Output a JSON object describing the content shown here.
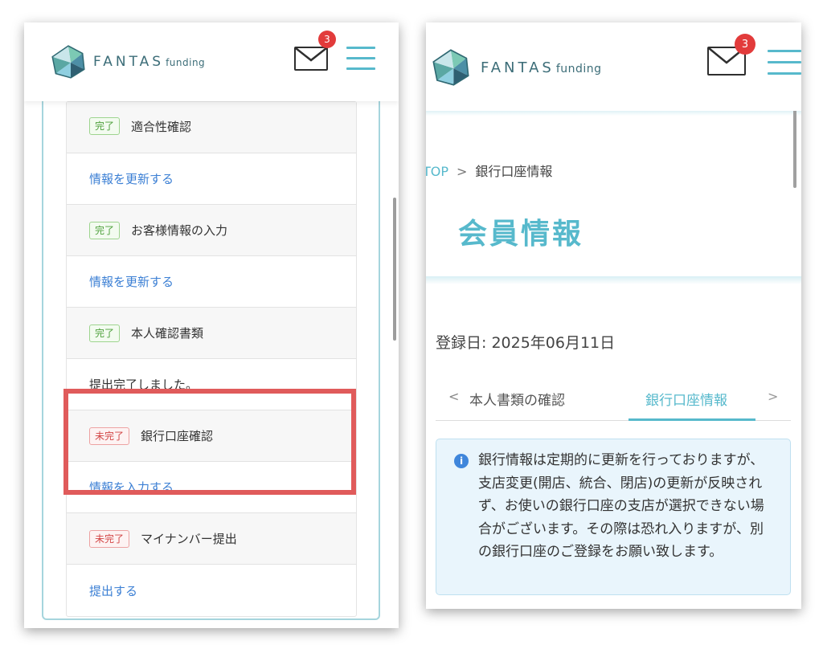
{
  "left": {
    "logo_main": "FANTAS",
    "logo_sub": "funding",
    "mail_badge": "3",
    "rows": [
      {
        "type": "status",
        "status": "完了",
        "label": "適合性確認"
      },
      {
        "type": "link",
        "label": "情報を更新する"
      },
      {
        "type": "status",
        "status": "完了",
        "label": "お客様情報の入力"
      },
      {
        "type": "link",
        "label": "情報を更新する"
      },
      {
        "type": "status",
        "status": "完了",
        "label": "本人確認書類"
      },
      {
        "type": "text",
        "label": "提出完了しました。"
      },
      {
        "type": "status",
        "status": "未完了",
        "label": "銀行口座確認"
      },
      {
        "type": "link",
        "label": "情報を入力する"
      },
      {
        "type": "status",
        "status": "未完了",
        "label": "マイナンバー提出"
      },
      {
        "type": "link",
        "label": "提出する"
      }
    ]
  },
  "right": {
    "logo_main": "FANTAS",
    "logo_sub": "funding",
    "mail_badge": "3",
    "breadcrumb_top": "TOP",
    "breadcrumb_sep": ">",
    "breadcrumb_current": "銀行口座情報",
    "page_title": "会員情報",
    "registration": "登録日: 2025年06月11日",
    "tab_prev": "<",
    "tab_documents": "本人書類の確認",
    "tab_bank": "銀行口座情報",
    "tab_next": ">",
    "notice": "銀行情報は定期的に更新を行っておりますが、支店変更(開店、統合、閉店)の更新が反映されず、お使いの銀行口座の支店が選択できない場合がございます。その際は恐れ入りますが、別の銀行口座のご登録をお願い致します。"
  },
  "colors": {
    "accent": "#57b9cc",
    "link": "#3b7fd4",
    "done": "#4da03b",
    "pending": "#d24545",
    "highlight": "#e05b5b"
  }
}
